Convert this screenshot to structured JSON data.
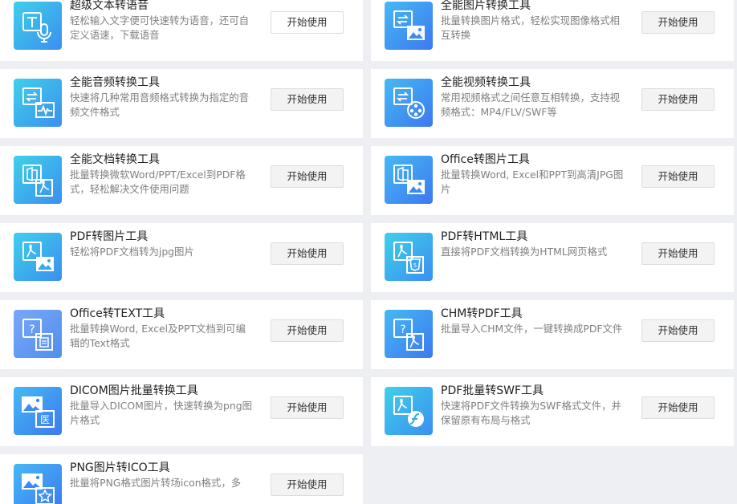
{
  "colors": {
    "page_bg": "#eeeff3",
    "card_bg": "#ffffff",
    "title": "#222222",
    "desc": "#808080",
    "button_bg": "#f3f3f3",
    "button_border": "#dcdcdc"
  },
  "tools": [
    {
      "title": "超级文本转语音",
      "desc": "轻松输入文字便可快速转为语音，还可自定义语速，下载语音",
      "button": "开始使用",
      "icon": "text-to-speech-icon"
    },
    {
      "title": "全能图片转换工具",
      "desc": "批量转换图片格式，轻松实现图像格式相互转换",
      "button": "开始使用",
      "icon": "image-convert-icon"
    },
    {
      "title": "全能音频转换工具",
      "desc": "快速将几种常用音频格式转换为指定的音频文件格式",
      "button": "开始使用",
      "icon": "audio-convert-icon"
    },
    {
      "title": "全能视频转换工具",
      "desc": "常用视频格式之间任意互相转换，支持视频格式：MP4/FLV/SWF等",
      "button": "开始使用",
      "icon": "video-convert-icon"
    },
    {
      "title": "全能文档转换工具",
      "desc": "批量转换微软Word/PPT/Excel到PDF格式，轻松解决文件使用问题",
      "button": "开始使用",
      "icon": "document-convert-icon"
    },
    {
      "title": "Office转图片工具",
      "desc": "批量转换Word, Excel和PPT到高清JPG图片",
      "button": "开始使用",
      "icon": "office-to-image-icon"
    },
    {
      "title": "PDF转图片工具",
      "desc": "轻松将PDF文档转为jpg图片",
      "button": "开始使用",
      "icon": "pdf-to-image-icon"
    },
    {
      "title": "PDF转HTML工具",
      "desc": "直接将PDF文档转换为HTML网页格式",
      "button": "开始使用",
      "icon": "pdf-to-html-icon"
    },
    {
      "title": "Office转TEXT工具",
      "desc": "批量转换Word, Excel及PPT文档到可编辑的Text格式",
      "button": "开始使用",
      "icon": "office-to-text-icon"
    },
    {
      "title": "CHM转PDF工具",
      "desc": "批量导入CHM文件，一键转换成PDF文件",
      "button": "开始使用",
      "icon": "chm-to-pdf-icon"
    },
    {
      "title": "DICOM图片批量转换工具",
      "desc": "批量导入DICOM图片，快速转换为png图片格式",
      "button": "开始使用",
      "icon": "dicom-convert-icon"
    },
    {
      "title": "PDF批量转SWF工具",
      "desc": "快速将PDF文件转换为SWF格式文件，并保留原有布局与格式",
      "button": "开始使用",
      "icon": "pdf-to-swf-icon"
    },
    {
      "title": "PNG图片转ICO工具",
      "desc": "批量将PNG格式图片转场icon格式，多",
      "button": "开始使用",
      "icon": "png-to-ico-icon"
    }
  ]
}
